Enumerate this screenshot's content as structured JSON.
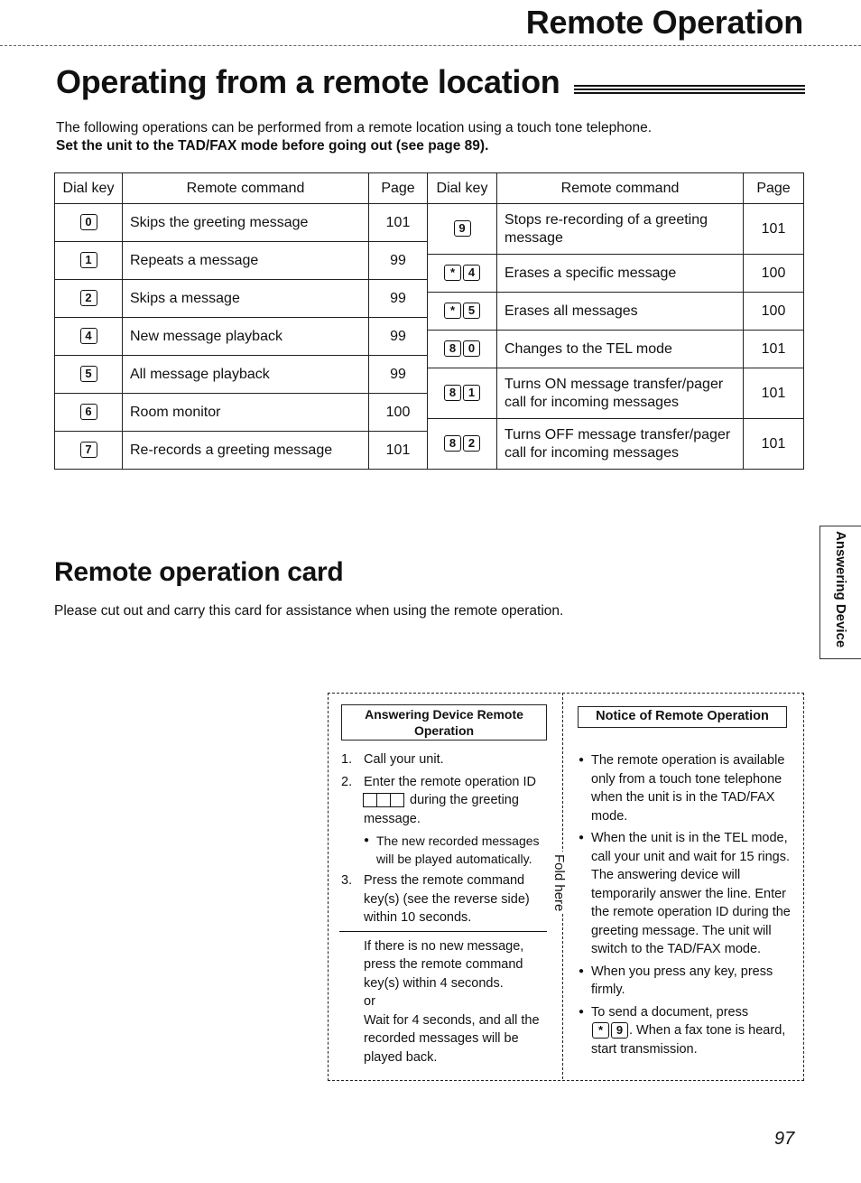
{
  "header": {
    "section_title": "Remote Operation"
  },
  "main": {
    "title": "Operating from a remote location",
    "intro": "The following operations can be performed from a remote location using a touch tone telephone.",
    "intro_bold": "Set the unit to the TAD/FAX mode before going out (see page 89).",
    "table_headers": {
      "dial_key": "Dial key",
      "command": "Remote command",
      "page": "Page"
    },
    "left_rows": [
      {
        "keys": [
          "0"
        ],
        "command": "Skips the greeting message",
        "page": "101"
      },
      {
        "keys": [
          "1"
        ],
        "command": "Repeats a message",
        "page": "99"
      },
      {
        "keys": [
          "2"
        ],
        "command": "Skips a message",
        "page": "99"
      },
      {
        "keys": [
          "4"
        ],
        "command": "New message playback",
        "page": "99"
      },
      {
        "keys": [
          "5"
        ],
        "command": "All message playback",
        "page": "99"
      },
      {
        "keys": [
          "6"
        ],
        "command": "Room monitor",
        "page": "100"
      },
      {
        "keys": [
          "7"
        ],
        "command": "Re-records a greeting message",
        "page": "101"
      }
    ],
    "right_rows": [
      {
        "keys": [
          "9"
        ],
        "command": "Stops re-recording of a greeting message",
        "page": "101"
      },
      {
        "keys": [
          "*",
          "4"
        ],
        "command": "Erases a specific message",
        "page": "100"
      },
      {
        "keys": [
          "*",
          "5"
        ],
        "command": "Erases all messages",
        "page": "100"
      },
      {
        "keys": [
          "8",
          "0"
        ],
        "command": "Changes to the TEL mode",
        "page": "101"
      },
      {
        "keys": [
          "8",
          "1"
        ],
        "command": "Turns ON message transfer/pager call for incoming messages",
        "page": "101"
      },
      {
        "keys": [
          "8",
          "2"
        ],
        "command": "Turns OFF message transfer/pager call for incoming messages",
        "page": "101"
      }
    ]
  },
  "card_section": {
    "title": "Remote operation card",
    "intro": "Please cut out and carry this card for assistance when using the remote operation.",
    "fold_label": "Fold here",
    "left": {
      "title": "Answering Device Remote Operation",
      "steps": [
        {
          "num": "1.",
          "text": "Call your unit."
        },
        {
          "num": "2.",
          "text_before": "Enter the remote operation ID",
          "text_after": "during the greeting message.",
          "sub_bullet": "The new recorded messages will be played automatically."
        },
        {
          "num": "3.",
          "text": "Press the remote command key(s) (see the reverse side) within 10 seconds."
        }
      ],
      "note_lines": [
        "If there is no new message, press the remote command key(s) within 4 seconds.",
        "or",
        "Wait for 4 seconds, and all the recorded messages will be played back."
      ]
    },
    "right": {
      "title": "Notice of Remote Operation",
      "bullets": [
        "The remote operation is available only from a touch tone telephone when the unit is in the TAD/FAX mode.",
        "When the unit is in the TEL mode, call your unit and wait for 15 rings. The answering device will temporarily answer the line. Enter the remote operation ID during the greeting message. The unit will switch to the TAD/FAX mode.",
        "When you press any key, press firmly."
      ],
      "last_bullet": {
        "before": "To send a document, press",
        "keys": [
          "*",
          "9"
        ],
        "after": ". When a fax tone is heard, start transmission."
      }
    }
  },
  "side_tab": {
    "label": "Answering Device"
  },
  "footer": {
    "page_number": "97"
  }
}
